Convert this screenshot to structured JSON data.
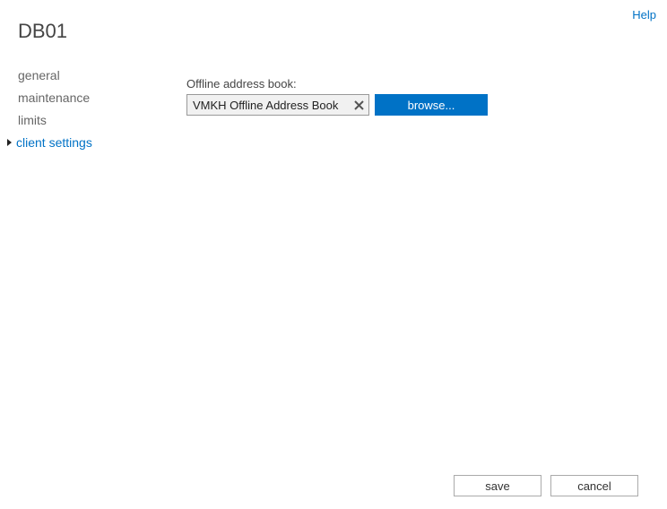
{
  "header": {
    "help_link": "Help",
    "title": "DB01"
  },
  "sidebar": {
    "items": [
      {
        "label": "general",
        "active": false
      },
      {
        "label": "maintenance",
        "active": false
      },
      {
        "label": "limits",
        "active": false
      },
      {
        "label": "client settings",
        "active": true
      }
    ]
  },
  "main": {
    "offline_address_book": {
      "label": "Offline address book:",
      "value": "VMKH Offline Address Book",
      "browse_label": "browse..."
    }
  },
  "footer": {
    "save_label": "save",
    "cancel_label": "cancel"
  }
}
